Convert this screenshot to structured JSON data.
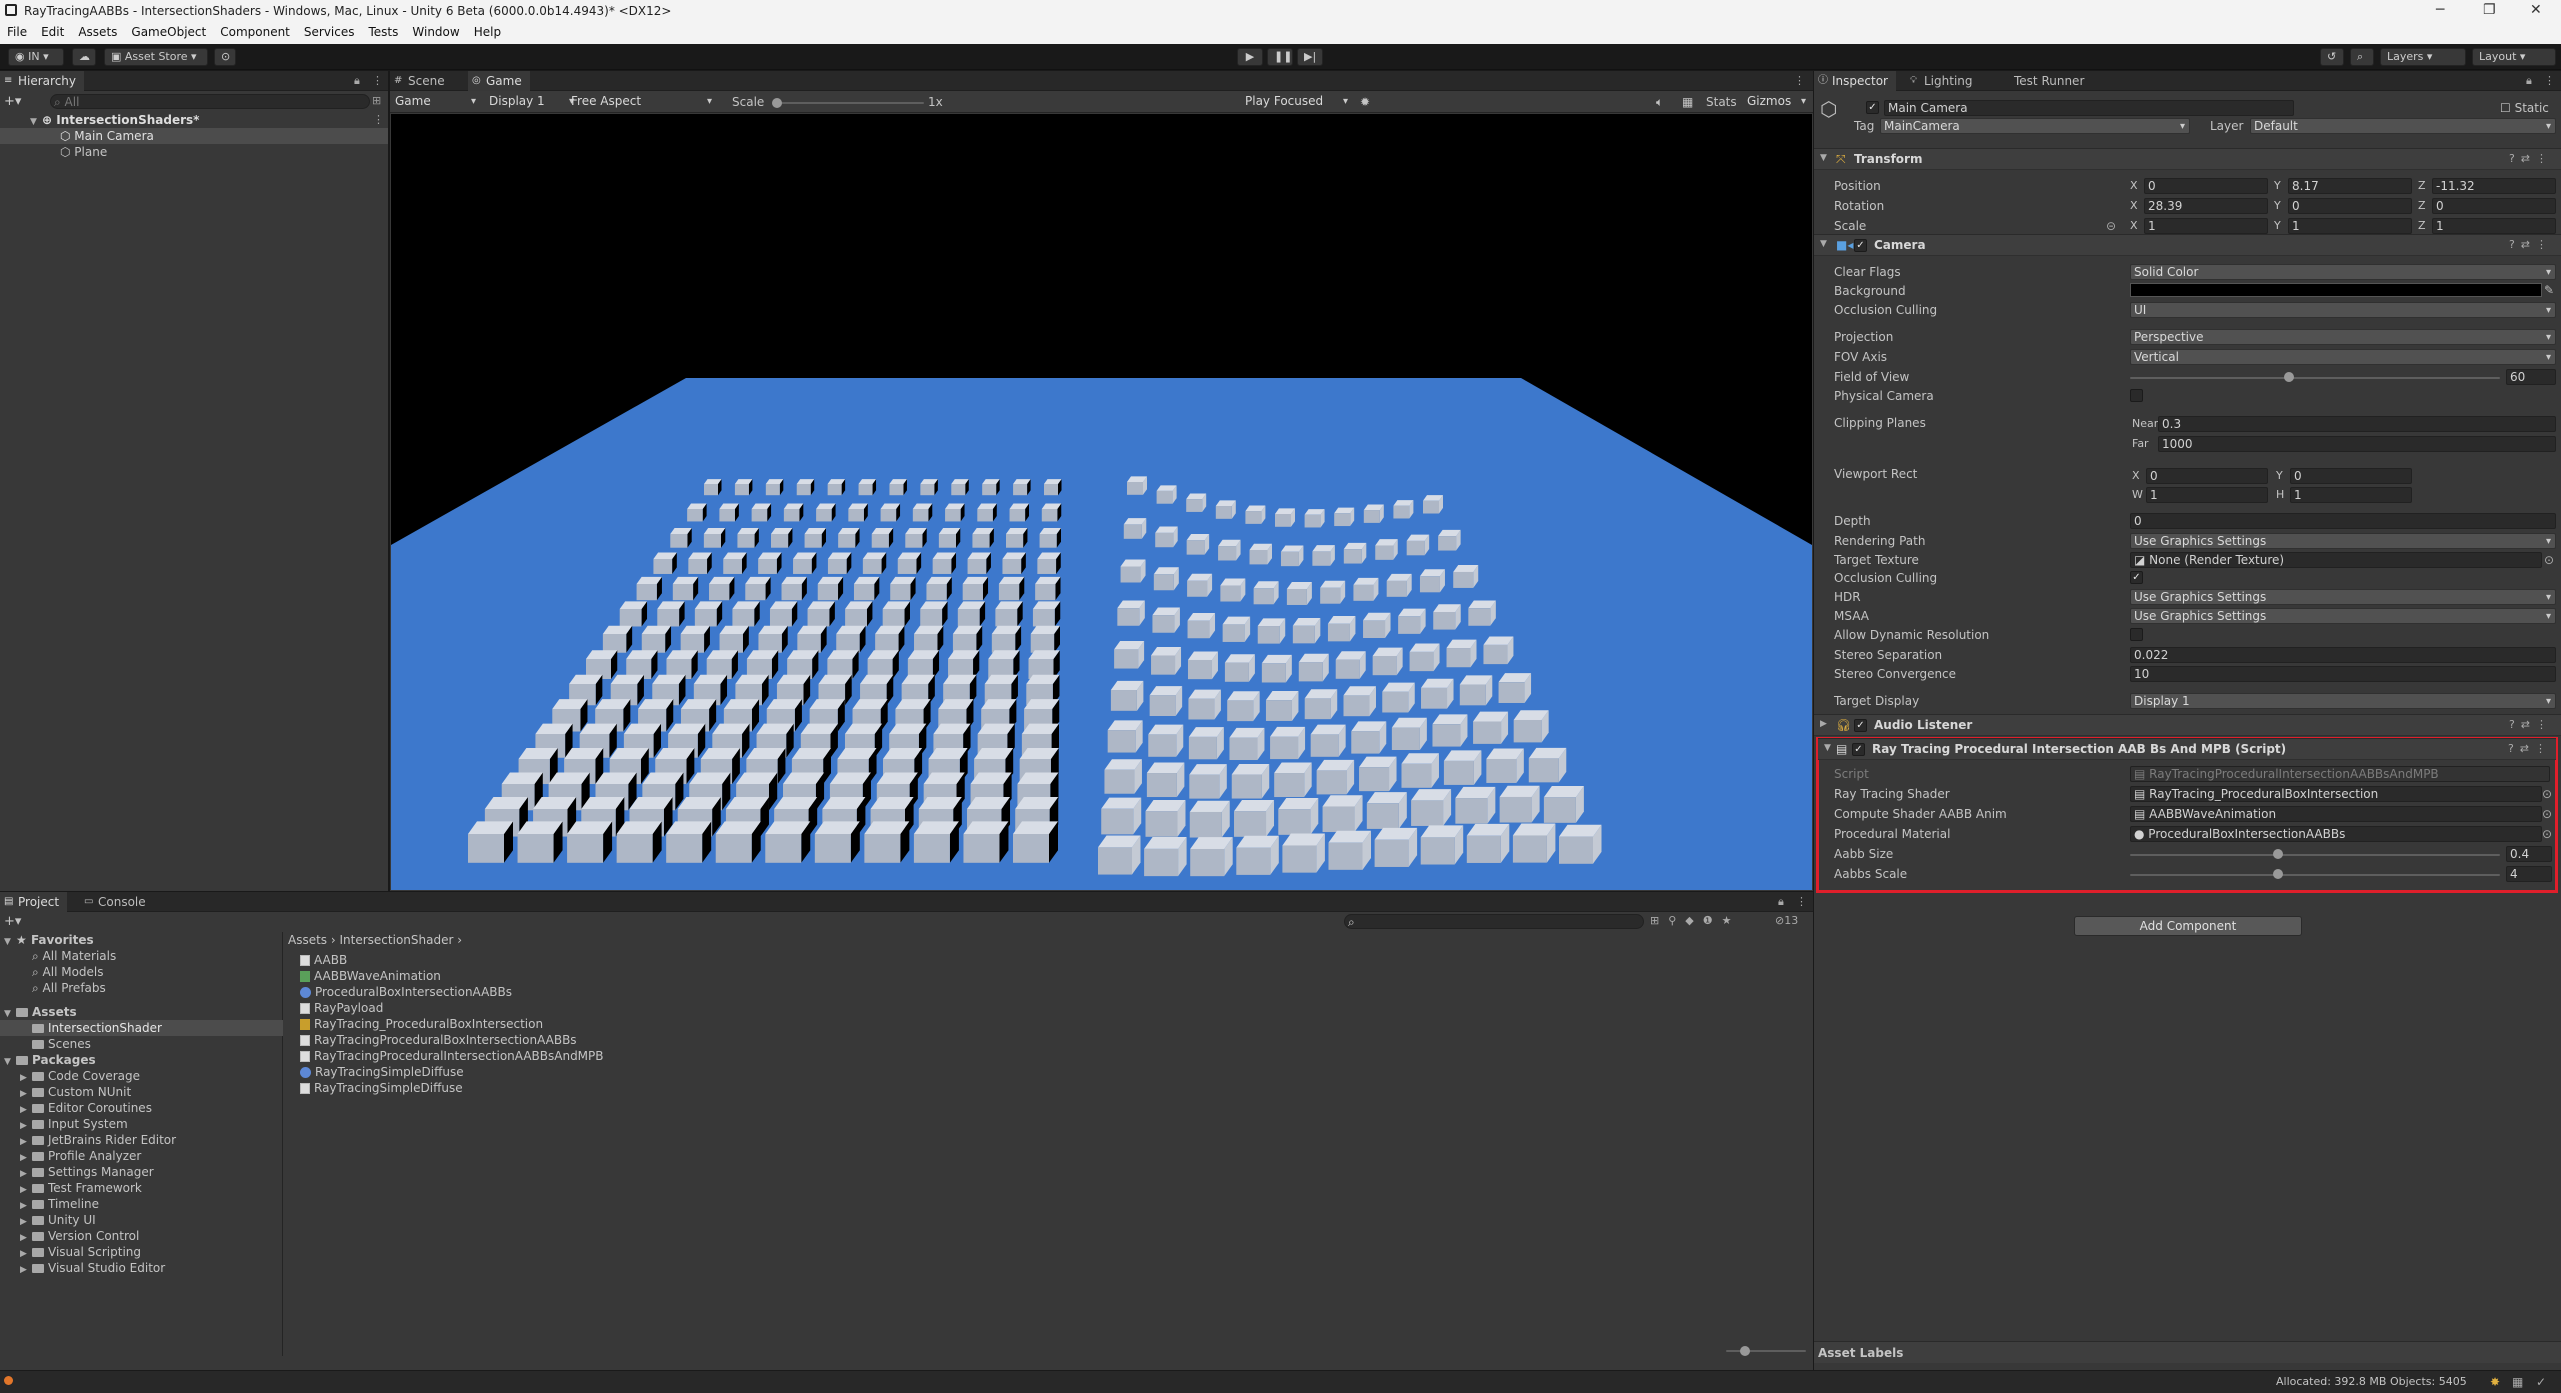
{
  "window": {
    "title": "RayTracingAABBs - IntersectionShaders - Windows, Mac, Linux - Unity 6 Beta (6000.0.0b14.4943)* <DX12>"
  },
  "menu": [
    "File",
    "Edit",
    "Assets",
    "GameObject",
    "Component",
    "Services",
    "Tests",
    "Window",
    "Help"
  ],
  "toolbar": {
    "account": "IN",
    "asset_store": "Asset Store",
    "layers": "Layers",
    "layout": "Layout"
  },
  "hierarchy": {
    "tab": "Hierarchy",
    "search_placeholder": "All",
    "scene": "IntersectionShaders*",
    "items": [
      "Main Camera",
      "Plane"
    ]
  },
  "game_view": {
    "tabs": [
      "Scene",
      "Game"
    ],
    "mode": "Game",
    "display": "Display 1",
    "aspect": "Free Aspect",
    "scale_label": "Scale",
    "scale_value": "1x",
    "play_mode": "Play Focused",
    "stats": "Stats",
    "gizmos": "Gizmos"
  },
  "inspector": {
    "tabs": [
      "Inspector",
      "Lighting",
      "Test Runner"
    ],
    "object_name": "Main Camera",
    "static_label": "Static",
    "tag_label": "Tag",
    "tag": "MainCamera",
    "layer_label": "Layer",
    "layer": "Default",
    "transform": {
      "title": "Transform",
      "position_label": "Position",
      "rotation_label": "Rotation",
      "scale_label": "Scale",
      "position": {
        "x": "0",
        "y": "8.17",
        "z": "-11.32"
      },
      "rotation": {
        "x": "28.39",
        "y": "0",
        "z": "0"
      },
      "scale": {
        "x": "1",
        "y": "1",
        "z": "1"
      }
    },
    "camera": {
      "title": "Camera",
      "clear_flags_label": "Clear Flags",
      "clear_flags": "Solid Color",
      "background_label": "Background",
      "occlusion_label": "Occlusion Culling",
      "occlusion_value": "UI",
      "projection_label": "Projection",
      "projection": "Perspective",
      "fov_axis_label": "FOV Axis",
      "fov_axis": "Vertical",
      "fov_label": "Field of View",
      "fov": "60",
      "fov_fraction": 0.43,
      "physical_label": "Physical Camera",
      "clipping_label": "Clipping Planes",
      "near_label": "Near",
      "near": "0.3",
      "far_label": "Far",
      "far": "1000",
      "viewport_label": "Viewport Rect",
      "vp": {
        "x": "0",
        "y": "0",
        "w": "1",
        "h": "1"
      },
      "depth_label": "Depth",
      "depth": "0",
      "rendering_path_label": "Rendering Path",
      "rendering_path": "Use Graphics Settings",
      "target_texture_label": "Target Texture",
      "target_texture": "None (Render Texture)",
      "occlusion2_label": "Occlusion Culling",
      "hdr_label": "HDR",
      "hdr": "Use Graphics Settings",
      "msaa_label": "MSAA",
      "msaa": "Use Graphics Settings",
      "dyn_res_label": "Allow Dynamic Resolution",
      "stereo_sep_label": "Stereo Separation",
      "stereo_sep": "0.022",
      "stereo_conv_label": "Stereo Convergence",
      "stereo_conv": "10",
      "target_display_label": "Target Display",
      "target_display": "Display 1"
    },
    "audio_listener": {
      "title": "Audio Listener"
    },
    "script_component": {
      "title": "Ray Tracing Procedural Intersection AAB Bs And MPB (Script)",
      "script_label": "Script",
      "script": "RayTracingProceduralIntersectionAABBsAndMPB",
      "ray_shader_label": "Ray Tracing Shader",
      "ray_shader": "RayTracing_ProceduralBoxIntersection",
      "compute_label": "Compute Shader AABB Anim",
      "compute": "AABBWaveAnimation",
      "material_label": "Procedural Material",
      "material": "ProceduralBoxIntersectionAABBs",
      "aabb_size_label": "Aabb Size",
      "aabb_size": "0.4",
      "aabb_size_fraction": 0.4,
      "aabbs_scale_label": "Aabbs Scale",
      "aabbs_scale": "4",
      "aabbs_scale_fraction": 0.4
    },
    "add_component": "Add Component",
    "asset_labels": "Asset Labels"
  },
  "project": {
    "tabs": [
      "Project",
      "Console"
    ],
    "hidden_count": "13",
    "favorites_label": "Favorites",
    "favorites": [
      "All Materials",
      "All Models",
      "All Prefabs"
    ],
    "assets_label": "Assets",
    "assets_children": [
      "IntersectionShader",
      "Scenes"
    ],
    "packages_label": "Packages",
    "packages": [
      "Code Coverage",
      "Custom NUnit",
      "Editor Coroutines",
      "Input System",
      "JetBrains Rider Editor",
      "Profile Analyzer",
      "Settings Manager",
      "Test Framework",
      "Timeline",
      "Unity UI",
      "Version Control",
      "Visual Scripting",
      "Visual Studio Editor"
    ],
    "breadcrumb": [
      "Assets",
      "IntersectionShader"
    ],
    "files": [
      {
        "name": "AABB",
        "kind": "file"
      },
      {
        "name": "AABBWaveAnimation",
        "kind": "compute"
      },
      {
        "name": "ProceduralBoxIntersectionAABBs",
        "kind": "material"
      },
      {
        "name": "RayPayload",
        "kind": "file"
      },
      {
        "name": "RayTracing_ProceduralBoxIntersection",
        "kind": "shader"
      },
      {
        "name": "RayTracingProceduralBoxIntersectionAABBs",
        "kind": "file"
      },
      {
        "name": "RayTracingProceduralIntersectionAABBsAndMPB",
        "kind": "file"
      },
      {
        "name": "RayTracingSimpleDiffuse",
        "kind": "material"
      },
      {
        "name": "RayTracingSimpleDiffuse",
        "kind": "file"
      }
    ]
  },
  "status": {
    "memory": "Allocated: 392.8 MB Objects: 5405"
  },
  "colors": {
    "plane": "#3d78cc",
    "highlight": "#e01f2b",
    "game_bg": "#000000"
  }
}
